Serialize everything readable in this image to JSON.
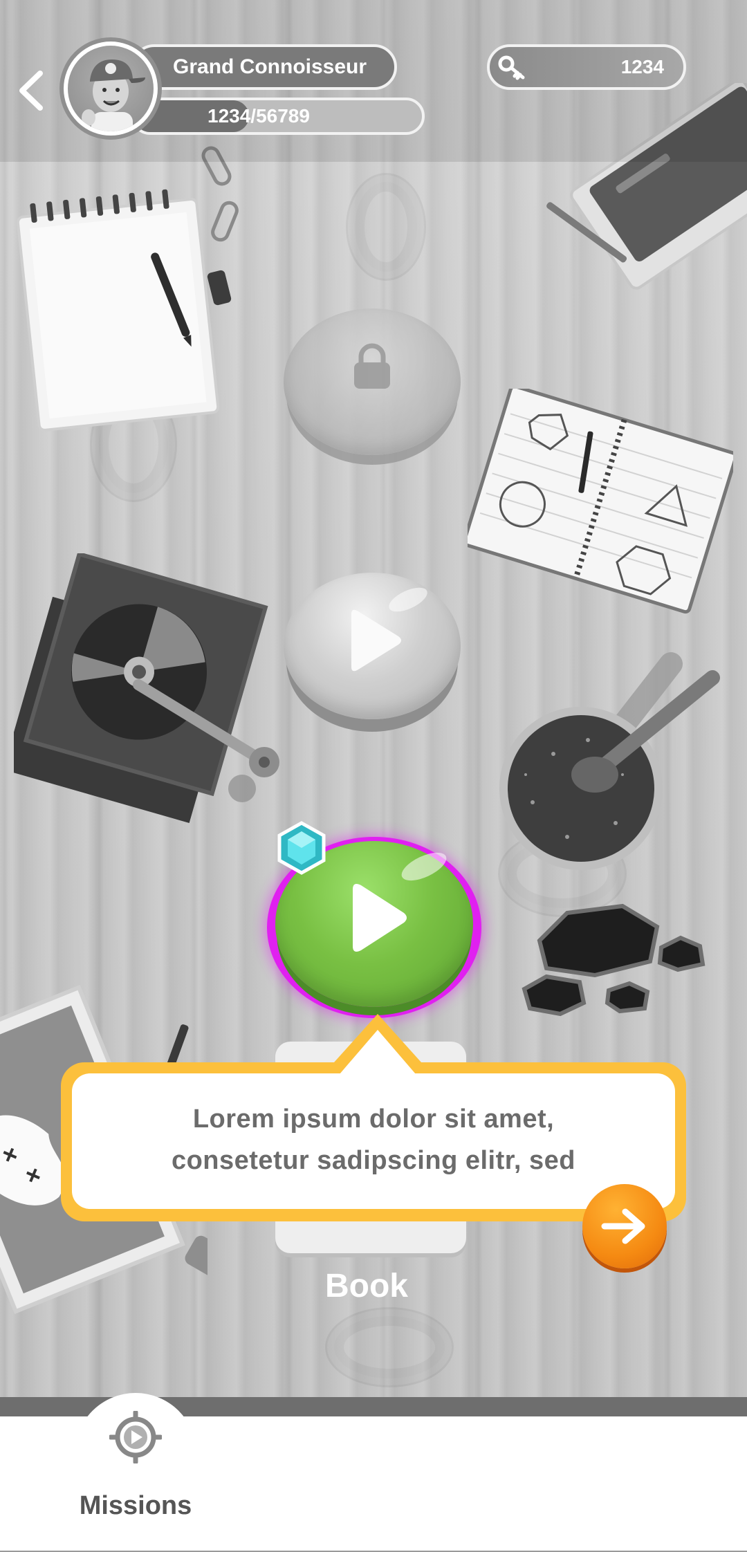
{
  "header": {
    "player_title": "Grand Connoisseur",
    "xp_text": "1234/56789",
    "xp_progress": 0.022,
    "keys_count": "1234",
    "icons": {
      "back": "chevron-left-icon",
      "keys": "key-icon",
      "avatar": "player-avatar"
    }
  },
  "map": {
    "levels": [
      {
        "state": "locked",
        "icon": "lock-icon"
      },
      {
        "state": "completed",
        "icon": "play-icon"
      },
      {
        "state": "current",
        "icon": "play-icon",
        "reward_icon": "gem-icon"
      }
    ]
  },
  "tooltip": {
    "text": "Lorem ipsum dolor sit amet, consetetur sadipscing elitr, sed",
    "line1": "Lorem ipsum dolor sit amet,",
    "line2": "consetetur sadipscing elitr, sed",
    "next_icon": "arrow-right-icon"
  },
  "book": {
    "label": "Book"
  },
  "bottom_nav": {
    "tabs": [
      {
        "label": "Missions",
        "icon": "missions-target-icon",
        "active": true
      }
    ]
  },
  "colors": {
    "accent_green": "#79c043",
    "highlight_magenta": "#e020f0",
    "bubble_yellow": "#fcc03c",
    "button_orange": "#f58a12",
    "gem_cyan": "#3fd6e0"
  }
}
